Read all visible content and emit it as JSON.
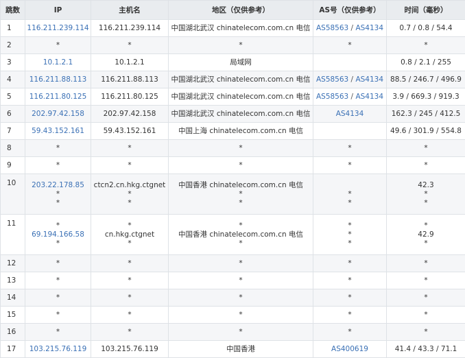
{
  "headers": [
    "跳数",
    "IP",
    "主机名",
    "地区（仅供参考）",
    "AS号（仅供参考）",
    "时间（毫秒）"
  ],
  "rows": [
    {
      "hop": "1",
      "ip": [
        "116.211.239.114"
      ],
      "host": [
        "116.211.239.114"
      ],
      "region": [
        "中国湖北武汉 chinatelecom.com.cn 电信"
      ],
      "as": [
        [
          "AS58563",
          "AS4134"
        ]
      ],
      "time": [
        "0.7 / 0.8 / 54.4"
      ]
    },
    {
      "hop": "2",
      "ip": [
        "*"
      ],
      "host": [
        "*"
      ],
      "region": [
        "*"
      ],
      "as": [
        "*"
      ],
      "time": [
        "*"
      ]
    },
    {
      "hop": "3",
      "ip": [
        "10.1.2.1"
      ],
      "host": [
        "10.1.2.1"
      ],
      "region": [
        "局域网"
      ],
      "as": [
        ""
      ],
      "time": [
        "0.8 / 2.1 / 255"
      ]
    },
    {
      "hop": "4",
      "ip": [
        "116.211.88.113"
      ],
      "host": [
        "116.211.88.113"
      ],
      "region": [
        "中国湖北武汉 chinatelecom.com.cn 电信"
      ],
      "as": [
        [
          "AS58563",
          "AS4134"
        ]
      ],
      "time": [
        "88.5 / 246.7 / 496.9"
      ]
    },
    {
      "hop": "5",
      "ip": [
        "116.211.80.125"
      ],
      "host": [
        "116.211.80.125"
      ],
      "region": [
        "中国湖北武汉 chinatelecom.com.cn 电信"
      ],
      "as": [
        [
          "AS58563",
          "AS4134"
        ]
      ],
      "time": [
        "3.9 / 669.3 / 919.3"
      ]
    },
    {
      "hop": "6",
      "ip": [
        "202.97.42.158"
      ],
      "host": [
        "202.97.42.158"
      ],
      "region": [
        "中国湖北武汉 chinatelecom.com.cn 电信"
      ],
      "as": [
        [
          "AS4134"
        ]
      ],
      "time": [
        "162.3 / 245 / 412.5"
      ]
    },
    {
      "hop": "7",
      "ip": [
        "59.43.152.161"
      ],
      "host": [
        "59.43.152.161"
      ],
      "region": [
        "中国上海 chinatelecom.com.cn 电信"
      ],
      "as": [
        ""
      ],
      "time": [
        "49.6 / 301.9 / 554.8"
      ]
    },
    {
      "hop": "8",
      "ip": [
        "*"
      ],
      "host": [
        "*"
      ],
      "region": [
        "*"
      ],
      "as": [
        "*"
      ],
      "time": [
        "*"
      ]
    },
    {
      "hop": "9",
      "ip": [
        "*"
      ],
      "host": [
        "*"
      ],
      "region": [
        "*"
      ],
      "as": [
        "*"
      ],
      "time": [
        "*"
      ]
    },
    {
      "hop": "10",
      "ip": [
        "203.22.178.85",
        "*",
        "*"
      ],
      "host": [
        "ctcn2.cn.hkg.ctgnet",
        "*",
        "*"
      ],
      "region": [
        "中国香港 chinatelecom.com.cn 电信",
        "*",
        "*"
      ],
      "as": [
        "",
        "*",
        "*"
      ],
      "time": [
        "42.3",
        "*",
        "*"
      ]
    },
    {
      "hop": "11",
      "ip": [
        "*",
        "69.194.166.58",
        "*"
      ],
      "host": [
        "*",
        "cn.hkg.ctgnet",
        "*"
      ],
      "region": [
        "*",
        "中国香港 chinatelecom.com.cn 电信",
        "*"
      ],
      "as": [
        "*",
        "*",
        "*"
      ],
      "time": [
        "*",
        "42.9",
        "*"
      ]
    },
    {
      "hop": "12",
      "ip": [
        "*"
      ],
      "host": [
        "*"
      ],
      "region": [
        "*"
      ],
      "as": [
        "*"
      ],
      "time": [
        "*"
      ]
    },
    {
      "hop": "13",
      "ip": [
        "*"
      ],
      "host": [
        "*"
      ],
      "region": [
        "*"
      ],
      "as": [
        "*"
      ],
      "time": [
        "*"
      ]
    },
    {
      "hop": "14",
      "ip": [
        "*"
      ],
      "host": [
        "*"
      ],
      "region": [
        "*"
      ],
      "as": [
        "*"
      ],
      "time": [
        "*"
      ]
    },
    {
      "hop": "15",
      "ip": [
        "*"
      ],
      "host": [
        "*"
      ],
      "region": [
        "*"
      ],
      "as": [
        "*"
      ],
      "time": [
        "*"
      ]
    },
    {
      "hop": "16",
      "ip": [
        "*"
      ],
      "host": [
        "*"
      ],
      "region": [
        "*"
      ],
      "as": [
        "*"
      ],
      "time": [
        "*"
      ]
    },
    {
      "hop": "17",
      "ip": [
        "103.215.76.119"
      ],
      "host": [
        "103.215.76.119"
      ],
      "region": [
        "中国香港"
      ],
      "as": [
        [
          "AS400619"
        ]
      ],
      "time": [
        "41.4 / 43.3 / 71.1"
      ]
    }
  ]
}
